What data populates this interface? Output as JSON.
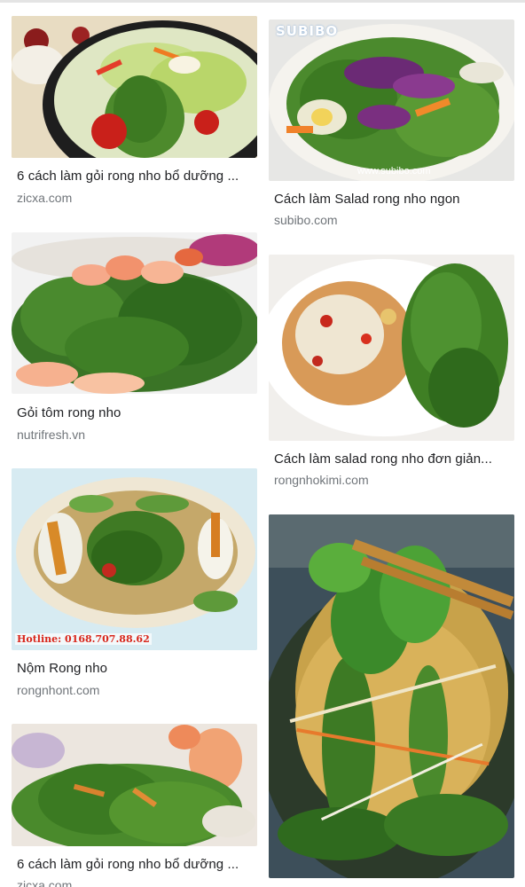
{
  "results": [
    {
      "title": "6 cách làm gỏi rong nho bổ dưỡng ...",
      "source": "zicxa.com"
    },
    {
      "title": "Cách làm Salad rong nho ngon",
      "source": "subibo.com",
      "watermark_logo": "SUBIBO",
      "watermark_url": "www.subibo.com"
    },
    {
      "title": "Gỏi tôm rong nho",
      "source": "nutrifresh.vn"
    },
    {
      "title": "Cách làm salad rong nho đơn giản...",
      "source": "rongnhokimi.com"
    },
    {
      "title": "Nộm Rong nho",
      "source": "rongnhont.com",
      "hotline": "Hotline: 0168.707.88.62"
    },
    {
      "title": "6 cách làm gỏi rong nho bổ dưỡng ...",
      "source": "zicxa.com"
    }
  ],
  "colors": {
    "seaweed": "#3f7d2a",
    "seaweed_dark": "#2a5a1c",
    "title_text": "#202124",
    "source_text": "#70757a"
  }
}
